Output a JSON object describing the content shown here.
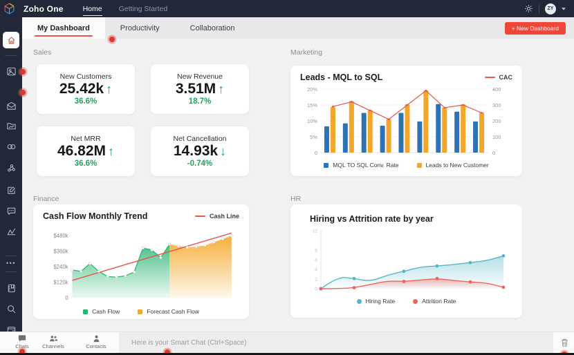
{
  "topbar": {
    "brand": "Zoho One",
    "nav": [
      {
        "label": "Home"
      },
      {
        "label": "Getting Started"
      }
    ],
    "avatar_initials": "ZY"
  },
  "tabbar": {
    "tabs": [
      {
        "label": "My Dashboard"
      },
      {
        "label": "Productivity"
      },
      {
        "label": "Collaboration"
      }
    ],
    "new_dashboard_label": "+ New Dashboard"
  },
  "sidebar": {
    "icons": [
      "home",
      "gallery",
      "mail",
      "folder",
      "connections",
      "network",
      "compose",
      "comments",
      "analytics",
      "more",
      "notebook",
      "search",
      "wallet"
    ]
  },
  "sections": {
    "sales": "Sales",
    "marketing": "Marketing",
    "finance": "Finance",
    "hr": "HR"
  },
  "sales_cards": [
    {
      "title": "New Customers",
      "value": "25.42k",
      "arrow": "↑",
      "delta": "36.6%"
    },
    {
      "title": "New Revenue",
      "value": "3.51M",
      "arrow": "↑",
      "delta": "18.7%"
    },
    {
      "title": "Net MRR",
      "value": "46.82M",
      "arrow": "↑",
      "delta": "36.6%"
    },
    {
      "title": "Net Cancellation",
      "value": "14.93k",
      "arrow": "↓",
      "delta": "-0.74%"
    }
  ],
  "chart_data": [
    {
      "type": "bar",
      "title": "Leads - MQL to SQL",
      "left_ticks": [
        "20%",
        "15%",
        "10%",
        "5%",
        "0"
      ],
      "left_tick_values": [
        20,
        15,
        10,
        5,
        0
      ],
      "left_max": 20,
      "right_ticks": [
        "400",
        "300",
        "200",
        "100",
        "0"
      ],
      "right_tick_values": [
        400,
        300,
        200,
        100,
        0
      ],
      "right_max": 400,
      "legend_position": "bottom",
      "series": [
        {
          "name": "MQL TO SQL Conv. Rate",
          "kind": "bar",
          "axis": "left",
          "color": "#2e72b4",
          "values": [
            8.3,
            9.2,
            12.5,
            8.5,
            12.5,
            9.8,
            15.3,
            12.9,
            9.8
          ]
        },
        {
          "name": "Leads to New Customer",
          "kind": "bar",
          "axis": "left",
          "color": "#f4a62a",
          "values": [
            14.4,
            16.2,
            13.4,
            10.6,
            15.2,
            19.6,
            14.2,
            15.2,
            12.6
          ]
        },
        {
          "name": "CAC",
          "kind": "line",
          "axis": "right",
          "color": "#e3574e",
          "values": [
            290,
            320,
            265,
            210,
            300,
            390,
            283,
            300,
            250
          ]
        }
      ]
    },
    {
      "type": "area",
      "title": "Cash Flow Monthly Trend",
      "y_ticks": [
        "$480k",
        "$360k",
        "$240k",
        "$120k",
        "0"
      ],
      "y_tick_values": [
        480,
        360,
        240,
        120,
        0
      ],
      "ylim": [
        0,
        520
      ],
      "x_points": 19,
      "series": [
        {
          "name": "Cash Flow",
          "kind": "area",
          "color": "#29b571",
          "start_index": 0,
          "values": [
            215,
            205,
            265,
            205,
            165,
            160,
            170,
            200,
            385,
            370,
            310,
            415
          ]
        },
        {
          "name": "Forecast Cash Flow",
          "kind": "area",
          "color": "#f5a623",
          "start_index": 11,
          "values": [
            415,
            400,
            390,
            395,
            405,
            430,
            455,
            480
          ]
        },
        {
          "name": "Cash Line",
          "kind": "line",
          "color": "#e8554d",
          "endpoints": [
            135,
            500
          ]
        }
      ]
    },
    {
      "type": "line",
      "title": "Hiring vs Attrition rate by year",
      "y_ticks": [
        "12",
        "8",
        "6",
        "4",
        "2",
        "0"
      ],
      "y_tick_values": [
        12,
        8,
        6,
        4,
        2,
        0
      ],
      "ylim": [
        0,
        12
      ],
      "series": [
        {
          "name": "Hiring Rate",
          "color": "#56b6c9",
          "points": [
            0,
            2.1,
            3.6,
            4.7,
            5.4,
            6.8
          ],
          "curve": [
            0,
            2.5,
            2.1,
            1.5,
            2.8,
            3.6,
            4.5,
            4.7,
            5.0,
            5.4,
            5.8,
            6.8
          ],
          "dot_indices": [
            0,
            2,
            5,
            7,
            9,
            11
          ]
        },
        {
          "name": "Attrition Rate",
          "color": "#ee645c",
          "points": [
            0,
            0.2,
            1.6,
            1.8,
            1.4,
            0.3
          ],
          "curve": [
            0,
            0.0,
            0.2,
            0.9,
            1.6,
            1.5,
            1.8,
            2.1,
            1.7,
            1.4,
            1.2,
            0.3
          ],
          "dot_indices": [
            0,
            2,
            5,
            7,
            9,
            11
          ]
        }
      ]
    }
  ],
  "bottombar": {
    "items": [
      {
        "label": "Chats"
      },
      {
        "label": "Channels"
      },
      {
        "label": "Contacts"
      }
    ],
    "smart_chat_placeholder": "Here is your Smart Chat (Ctrl+Space)"
  },
  "colors": {
    "topbar_bg": "#222838",
    "accent_red": "#ee4637",
    "kpi_green": "#23a164",
    "bar_blue": "#2e72b4",
    "bar_yellow": "#f4a62a",
    "cac_red": "#e3574e",
    "cash_green": "#29b571",
    "forecast_orange": "#f5a623",
    "cash_line_red": "#e8554d",
    "hiring_teal": "#56b6c9",
    "attrition_red": "#ee645c"
  }
}
